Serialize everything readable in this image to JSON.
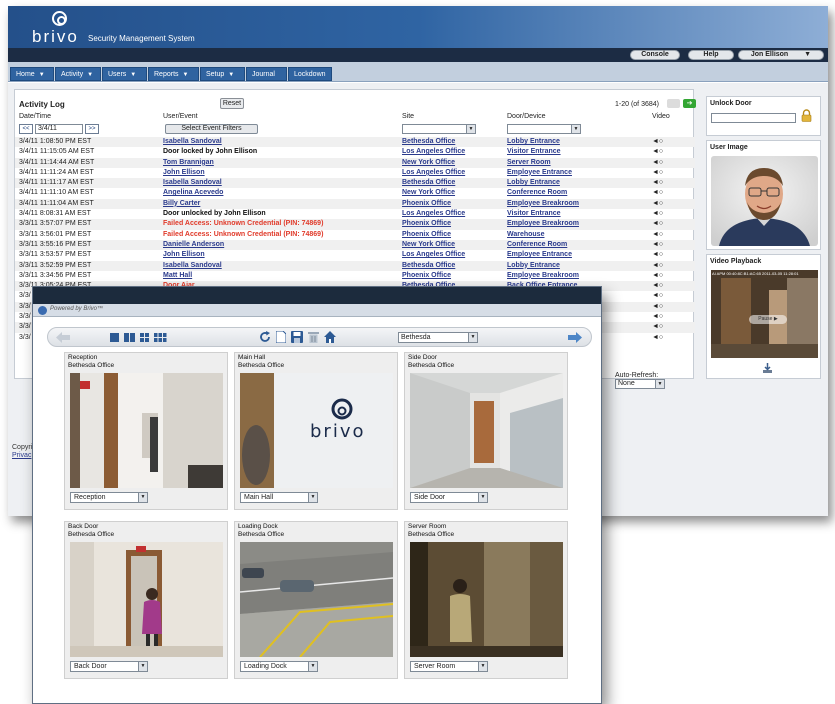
{
  "app": {
    "logo": "brivo",
    "title": "Security Management System"
  },
  "user_bar": {
    "console": "Console",
    "help": "Help",
    "user": "Jon Ellison",
    "user_caret": "▼"
  },
  "nav": {
    "tabs": [
      {
        "label": "Home",
        "caret": "▼"
      },
      {
        "label": "Activity",
        "caret": "▼"
      },
      {
        "label": "Users",
        "caret": "▼"
      },
      {
        "label": "Reports",
        "caret": "▼"
      },
      {
        "label": "Setup",
        "caret": "▼"
      },
      {
        "label": "Journal",
        "caret": ""
      },
      {
        "label": "Lockdown",
        "caret": ""
      }
    ]
  },
  "activity_log": {
    "title": "Activity Log",
    "reset": "Reset",
    "pager": "1-20 (of 3684)",
    "headers": {
      "date": "Date/Time",
      "user": "User/Event",
      "site": "Site",
      "door": "Door/Device",
      "video": "Video"
    },
    "date_prev": "<<",
    "date_value": "3/4/11",
    "date_next": ">>",
    "filter_button": "Select Event Filters",
    "auto_refresh_label": "Auto-Refresh:",
    "auto_refresh_value": "None",
    "rows": [
      {
        "date": "3/4/11 1:08:50 PM EST",
        "event": "Isabella Sandoval",
        "kind": "link",
        "site": "Bethesda Office",
        "door": "Lobby Entrance",
        "video": "◄○"
      },
      {
        "date": "3/4/11 11:15:05 AM EST",
        "event": "Door locked by John Ellison",
        "kind": "plain",
        "site": "Los Angeles Office",
        "door": "Visitor Entrance",
        "video": "◄○"
      },
      {
        "date": "3/4/11 11:14:44 AM EST",
        "event": "Tom Brannigan",
        "kind": "link",
        "site": "New York Office",
        "door": "Server Room",
        "video": "◄○"
      },
      {
        "date": "3/4/11 11:11:24 AM EST",
        "event": "John Ellison",
        "kind": "link",
        "site": "Los Angeles Office",
        "door": "Employee Entrance",
        "video": "◄○"
      },
      {
        "date": "3/4/11 11:11:17 AM EST",
        "event": "Isabella Sandoval",
        "kind": "link",
        "site": "Bethesda Office",
        "door": "Lobby Entrance",
        "video": "◄○"
      },
      {
        "date": "3/4/11 11:11:10 AM EST",
        "event": "Angelina Acevedo",
        "kind": "link",
        "site": "New York Office",
        "door": "Conference Room",
        "video": "◄○"
      },
      {
        "date": "3/4/11 11:11:04 AM EST",
        "event": "Billy Carter",
        "kind": "link",
        "site": "Phoenix Office",
        "door": "Employee Breakroom",
        "video": "◄○"
      },
      {
        "date": "3/4/11 8:08:31 AM EST",
        "event": "Door unlocked by John Ellison",
        "kind": "plain",
        "site": "Los Angeles Office",
        "door": "Visitor Entrance",
        "video": "◄○"
      },
      {
        "date": "3/3/11 3:57:07 PM EST",
        "event": "Failed Access: Unknown Credential (PIN: 74869)",
        "kind": "alert",
        "site": "Phoenix Office",
        "door": "Employee Breakroom",
        "video": "◄○"
      },
      {
        "date": "3/3/11 3:56:01 PM EST",
        "event": "Failed Access: Unknown Credential (PIN: 74869)",
        "kind": "alert",
        "site": "Phoenix Office",
        "door": "Warehouse",
        "video": "◄○"
      },
      {
        "date": "3/3/11 3:55:16 PM EST",
        "event": "Danielle Anderson",
        "kind": "link",
        "site": "New York Office",
        "door": "Conference Room",
        "video": "◄○"
      },
      {
        "date": "3/3/11 3:53:57 PM EST",
        "event": "John Ellison",
        "kind": "link",
        "site": "Los Angeles Office",
        "door": "Employee Entrance",
        "video": "◄○"
      },
      {
        "date": "3/3/11 3:52:59 PM EST",
        "event": "Isabella Sandoval",
        "kind": "link",
        "site": "Bethesda Office",
        "door": "Lobby Entrance",
        "video": "◄○"
      },
      {
        "date": "3/3/11 3:34:56 PM EST",
        "event": "Matt Hall",
        "kind": "link",
        "site": "Phoenix Office",
        "door": "Employee Breakroom",
        "video": "◄○"
      },
      {
        "date": "3/3/11 3:05:24 PM EST",
        "event": "Door Ajar",
        "kind": "alert",
        "site": "Bethesda Office",
        "door": "Back Office Entrance",
        "video": "◄○"
      },
      {
        "date": "3/3/",
        "event": "",
        "kind": "plain",
        "site": "",
        "door": "",
        "video": "◄○"
      },
      {
        "date": "3/3/",
        "event": "",
        "kind": "plain",
        "site": "",
        "door": "",
        "video": "◄○"
      },
      {
        "date": "3/3/",
        "event": "",
        "kind": "plain",
        "site": "",
        "door": "",
        "video": "◄○"
      },
      {
        "date": "3/3/",
        "event": "",
        "kind": "plain",
        "site": "",
        "door": "",
        "video": "◄○"
      },
      {
        "date": "3/3/",
        "event": "",
        "kind": "plain",
        "site": "",
        "door": "",
        "video": "◄○"
      }
    ]
  },
  "side": {
    "unlock_title": "Unlock Door",
    "user_image_title": "User Image",
    "video_playback_title": "Video Playback",
    "video_timestamp": "AI APM 00:40:8C:B1:AC:65  2011-03-05 11:28:01",
    "video_pill": "Pause ▶"
  },
  "footer": {
    "copyright": "Copyri",
    "privacy": "Privac"
  },
  "camera_viewer": {
    "powered_by": "Powered by Brivo™",
    "location": "Bethesda",
    "tiles": [
      {
        "name": "Reception",
        "site": "Bethesda Office",
        "select": "Reception"
      },
      {
        "name": "Main Hall",
        "site": "Bethesda Office",
        "select": "Main Hall"
      },
      {
        "name": "Side Door",
        "site": "Bethesda Office",
        "select": "Side Door"
      },
      {
        "name": "Back Door",
        "site": "Bethesda Office",
        "select": "Back Door"
      },
      {
        "name": "Loading Dock",
        "site": "Bethesda Office",
        "select": "Loading Dock"
      },
      {
        "name": "Server Room",
        "site": "Bethesda Office",
        "select": "Server Room"
      }
    ],
    "wall_logo": "brivo"
  },
  "colors": {
    "banner": "#2f64a3",
    "nav_tab": "#2f63a0",
    "link": "#2a3a8c",
    "alert": "#e03a2a",
    "next_button": "#33a633"
  }
}
